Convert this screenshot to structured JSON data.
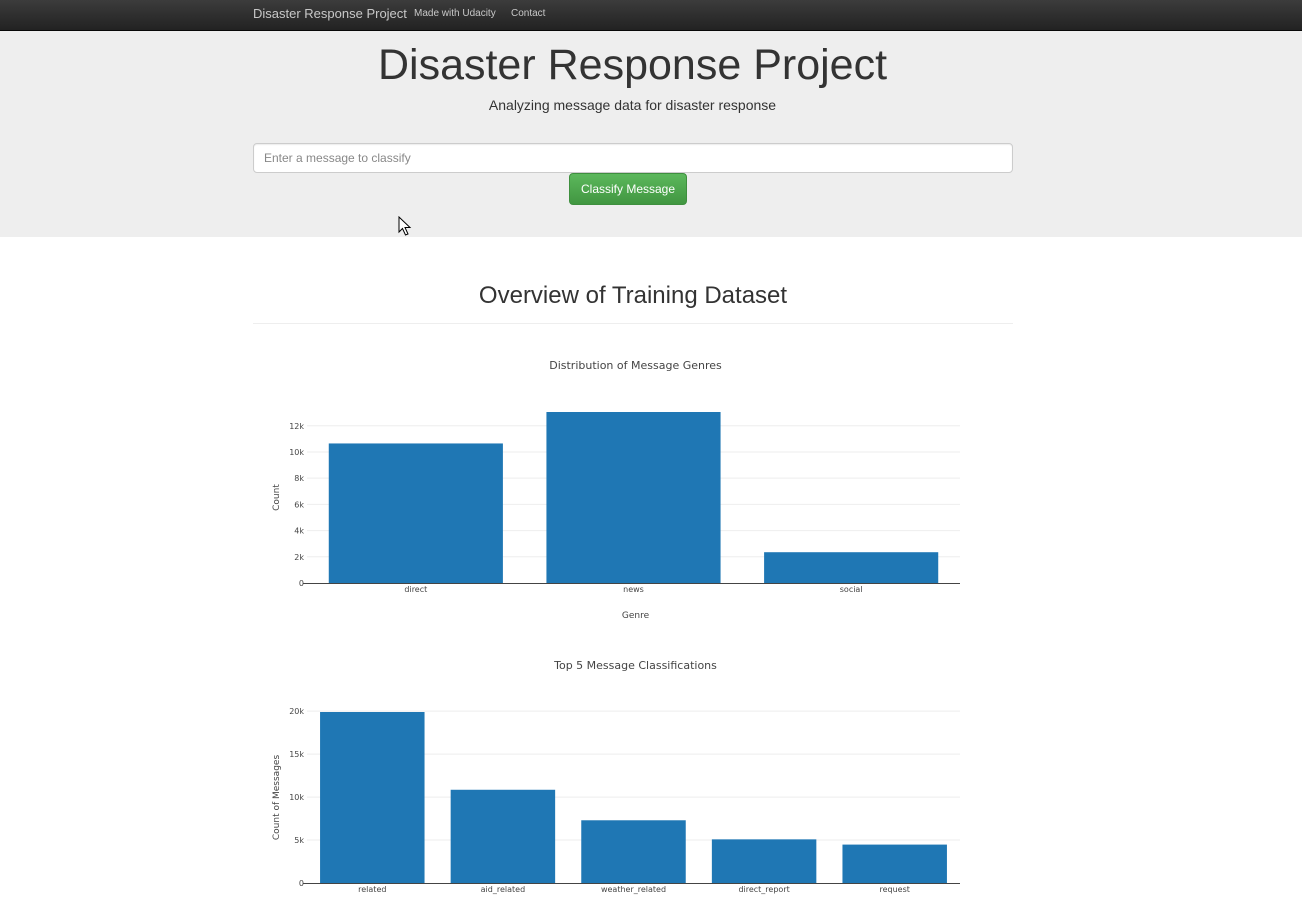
{
  "navbar": {
    "brand": "Disaster Response Project",
    "links": [
      "Made with Udacity",
      "Contact"
    ]
  },
  "hero": {
    "title": "Disaster Response Project",
    "subtitle": "Analyzing message data for disaster response",
    "input_placeholder": "Enter a message to classify",
    "button_label": "Classify Message"
  },
  "overview": {
    "title": "Overview of Training Dataset"
  },
  "colors": {
    "bar": "#1f77b4",
    "grid": "#eeeeee",
    "axis": "#444444"
  },
  "chart_data": [
    {
      "type": "bar",
      "title": "Distribution of Message Genres",
      "categories": [
        "direct",
        "news",
        "social"
      ],
      "values": [
        10650,
        13050,
        2350
      ],
      "xlabel": "Genre",
      "ylabel": "Count",
      "ylim": [
        0,
        13050
      ],
      "yticks": [
        0,
        2000,
        4000,
        6000,
        8000,
        10000,
        12000
      ],
      "ytick_labels": [
        "0",
        "2k",
        "4k",
        "6k",
        "8k",
        "10k",
        "12k"
      ],
      "grid": true
    },
    {
      "type": "bar",
      "title": "Top 5 Message Classifications",
      "categories": [
        "related",
        "aid_related",
        "weather_related",
        "direct_report",
        "request"
      ],
      "values": [
        19900,
        10850,
        7300,
        5080,
        4470
      ],
      "xlabel": "",
      "ylabel": "Count of Messages",
      "ylim": [
        0,
        19900
      ],
      "yticks": [
        0,
        5000,
        10000,
        15000,
        20000
      ],
      "ytick_labels": [
        "0",
        "5k",
        "10k",
        "15k",
        "20k"
      ],
      "grid": true
    }
  ]
}
